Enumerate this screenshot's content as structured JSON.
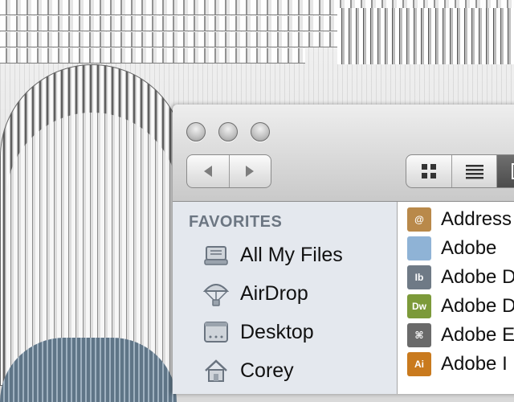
{
  "sidebar": {
    "heading": "FAVORITES",
    "items": [
      {
        "label": "All My Files",
        "icon": "all-my-files-icon"
      },
      {
        "label": "AirDrop",
        "icon": "airdrop-icon"
      },
      {
        "label": "Desktop",
        "icon": "desktop-icon"
      },
      {
        "label": "Corey",
        "icon": "home-icon"
      }
    ]
  },
  "files": [
    {
      "label": "Address",
      "icon": "address-book-app-icon",
      "icon_text": "@",
      "color": "#b9894a"
    },
    {
      "label": "Adobe",
      "icon": "folder-icon",
      "icon_text": "",
      "color": "#8fb3d6"
    },
    {
      "label": "Adobe D",
      "icon": "app-icon",
      "icon_text": "Ib",
      "color": "#6f7a86"
    },
    {
      "label": "Adobe D",
      "icon": "dreamweaver-icon",
      "icon_text": "Dw",
      "color": "#7c9a3a"
    },
    {
      "label": "Adobe E",
      "icon": "app-icon",
      "icon_text": "⌘",
      "color": "#6a6a6a"
    },
    {
      "label": "Adobe I",
      "icon": "illustrator-icon",
      "icon_text": "Ai",
      "color": "#c97a1e"
    }
  ],
  "colors": {
    "sidebar_bg": "#e4e8ee",
    "heading": "#6c7682"
  }
}
